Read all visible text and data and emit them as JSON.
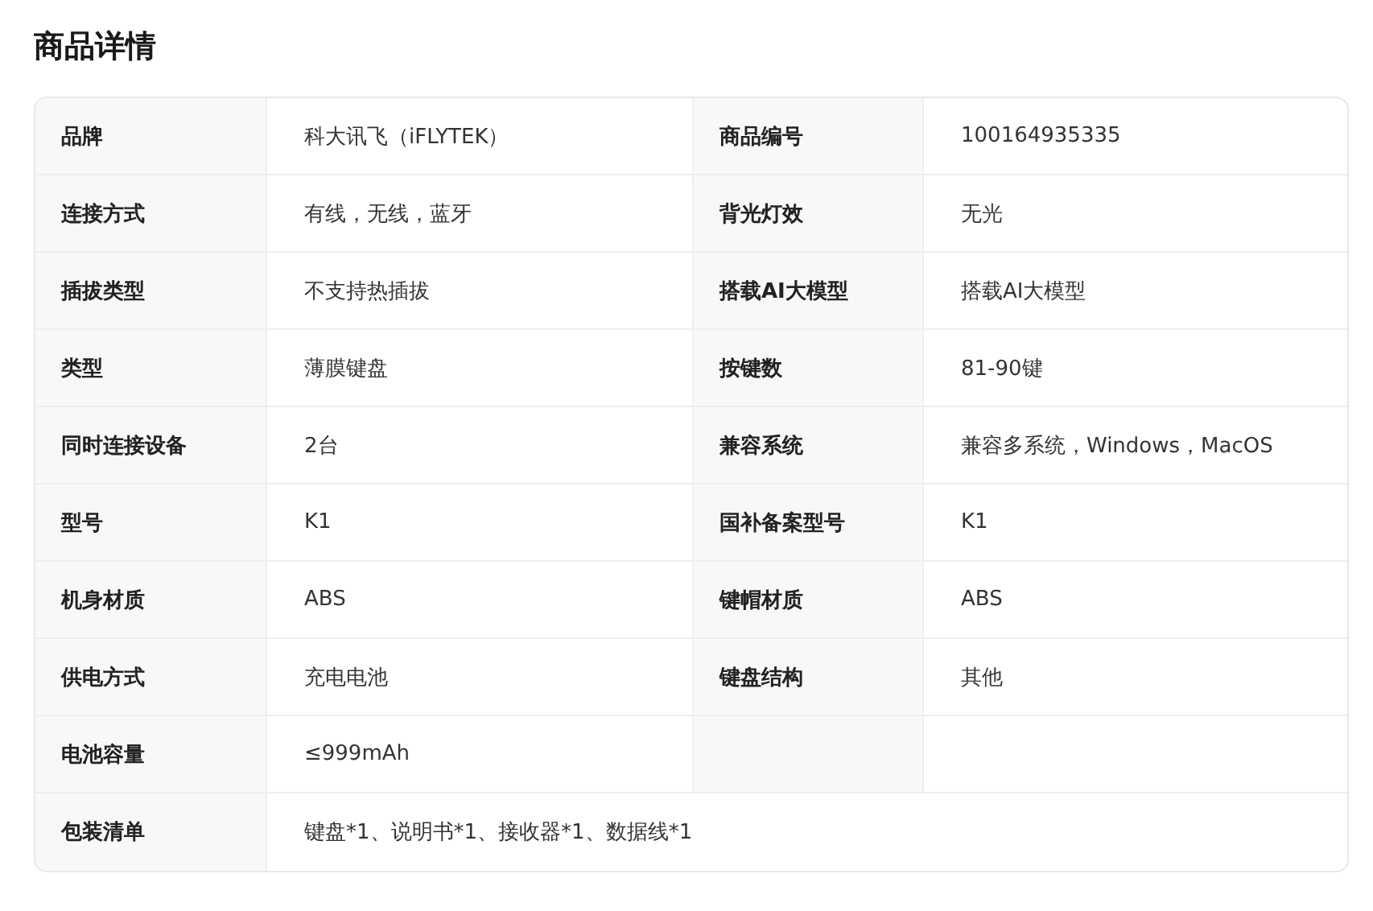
{
  "title": "商品详情",
  "rows": [
    {
      "kind": "double",
      "cells": [
        {
          "label": "品牌",
          "value": "科大讯飞（iFLYTEK）"
        },
        {
          "label": "商品编号",
          "value": "100164935335"
        }
      ]
    },
    {
      "kind": "double",
      "cells": [
        {
          "label": "连接方式",
          "value": "有线，无线，蓝牙"
        },
        {
          "label": "背光灯效",
          "value": "无光"
        }
      ]
    },
    {
      "kind": "double",
      "cells": [
        {
          "label": "插拔类型",
          "value": "不支持热插拔"
        },
        {
          "label": "搭载AI大模型",
          "value": "搭载AI大模型"
        }
      ]
    },
    {
      "kind": "double",
      "cells": [
        {
          "label": "类型",
          "value": "薄膜键盘"
        },
        {
          "label": "按键数",
          "value": "81-90键"
        }
      ]
    },
    {
      "kind": "double",
      "cells": [
        {
          "label": "同时连接设备",
          "value": "2台"
        },
        {
          "label": "兼容系统",
          "value": "兼容多系统，Windows，MacOS"
        }
      ]
    },
    {
      "kind": "double",
      "cells": [
        {
          "label": "型号",
          "value": "K1"
        },
        {
          "label": "国补备案型号",
          "value": "K1"
        }
      ]
    },
    {
      "kind": "double",
      "cells": [
        {
          "label": "机身材质",
          "value": "ABS"
        },
        {
          "label": "键帽材质",
          "value": "ABS"
        }
      ]
    },
    {
      "kind": "double",
      "cells": [
        {
          "label": "供电方式",
          "value": "充电电池"
        },
        {
          "label": "键盘结构",
          "value": "其他"
        }
      ]
    },
    {
      "kind": "single",
      "cells": [
        {
          "label": "电池容量",
          "value": "≤999mAh"
        }
      ]
    },
    {
      "kind": "full",
      "cells": [
        {
          "label": "包装清单",
          "value": "键盘*1、说明书*1、接收器*1、数据线*1"
        }
      ]
    }
  ]
}
